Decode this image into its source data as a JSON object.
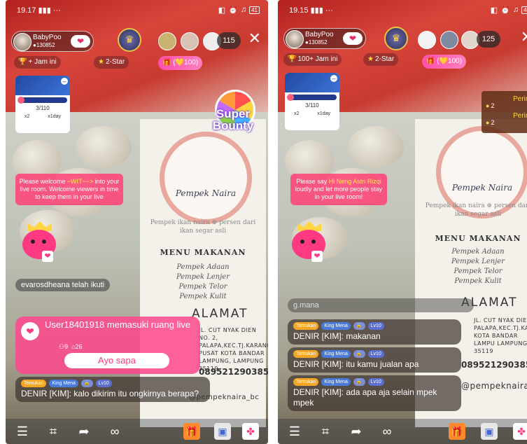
{
  "colors": {
    "pink": "#ff3a82",
    "gold": "#ffd640",
    "live_red": "#c83a30"
  },
  "panels": [
    {
      "status_time": "19.17",
      "status_dots": "···",
      "battery": "41",
      "host": {
        "name": "BabyPoo",
        "likes": "130852",
        "follow_icon": "heart-icon"
      },
      "viewer_count": "115",
      "pill_left": "+ Jam ini",
      "pill_right": "2-Star",
      "gift_bar": "(💛100)",
      "mini_card": {
        "count": "3/110",
        "left": "x2",
        "right": "x1day"
      },
      "bounty": "Super Bounty",
      "welcome": {
        "line1": "Please welcome ",
        "name": "~WIT~~>",
        "line2": " into your live room. Welcome viewers in time to keep them in your live"
      },
      "follow_notice": "evarosdheana telah ikuti",
      "join": {
        "text": "User18401918 memasuki ruang live",
        "stat1": "9",
        "stat2": "26",
        "button": "Ayo sapa"
      },
      "chats": [
        {
          "badges": [
            "Temukan",
            "King Mena",
            "",
            "Lv10"
          ],
          "text": "DENIR [KIM]: kalo dikirim itu ongkirnya berapa?"
        }
      ],
      "menu": {
        "brand": "Pempek Naira",
        "subtitle": "Pempek ikan naira ⊛ persen dari ikan segar asli",
        "heading": "MENU MAKANAN",
        "items": [
          "Pempek Adaan",
          "Pempek Lenjer",
          "Pempek Telor",
          "Pempek Kulit"
        ],
        "alamat": "ALAMAT",
        "address": "JL. CUT NYAK DIEN NO. 2, PALAPA,KEC.TJ.KARANG PUSAT KOTA BANDAR LAMPUNG, LAMPUNG 35119",
        "phone": "089521290385",
        "social": "@pempeknaira_bc"
      }
    },
    {
      "status_time": "19.15",
      "status_dots": "···",
      "battery": "40",
      "host": {
        "name": "BabyPoo",
        "likes": "130852",
        "follow_icon": "heart-icon"
      },
      "viewer_count": "125",
      "pill_left": "100+ Jam ini",
      "pill_right": "2-Star",
      "gift_bar": "(💛100)",
      "mini_card": {
        "count": "3/110",
        "left": "x2",
        "right": "x1day"
      },
      "pering": [
        {
          "label": "Pering",
          "coins": "2"
        },
        {
          "label": "Pering",
          "coins": "2"
        }
      ],
      "welcome": {
        "line1": "Please say ",
        "name": "Hi Neng Astri Rizqi",
        "line2": " loudly and let more people stay in your live room!"
      },
      "gmana": "g.mana",
      "chats": [
        {
          "badges": [
            "Temukan",
            "King Mena",
            "",
            "Lv10"
          ],
          "text": "DENIR [KIM]: makanan"
        },
        {
          "badges": [
            "Temukan",
            "King Mena",
            "",
            "Lv10"
          ],
          "text": "DENIR [KIM]: itu kamu jualan apa"
        },
        {
          "badges": [
            "Temukan",
            "King Mena",
            "",
            "Lv10"
          ],
          "text": "DENIR [KIM]: ada apa aja selain mpek mpek"
        }
      ],
      "menu": {
        "brand": "Pempek Naira",
        "subtitle": "Pempek ikan naira ⊛ persen dari ikan segar asli",
        "heading": "MENU MAKANAN",
        "items": [
          "Pempek Adaan",
          "Pempek Lenjer",
          "Pempek Telor",
          "Pempek Kulit"
        ],
        "alamat": "ALAMAT",
        "address": "JL. CUT NYAK DIEN N PALAPA,KEC.TJ.KARANG KOTA BANDAR LAMPU LAMPUNG 35119",
        "phone": "089521290385",
        "social": "@pempeknaira"
      }
    }
  ]
}
